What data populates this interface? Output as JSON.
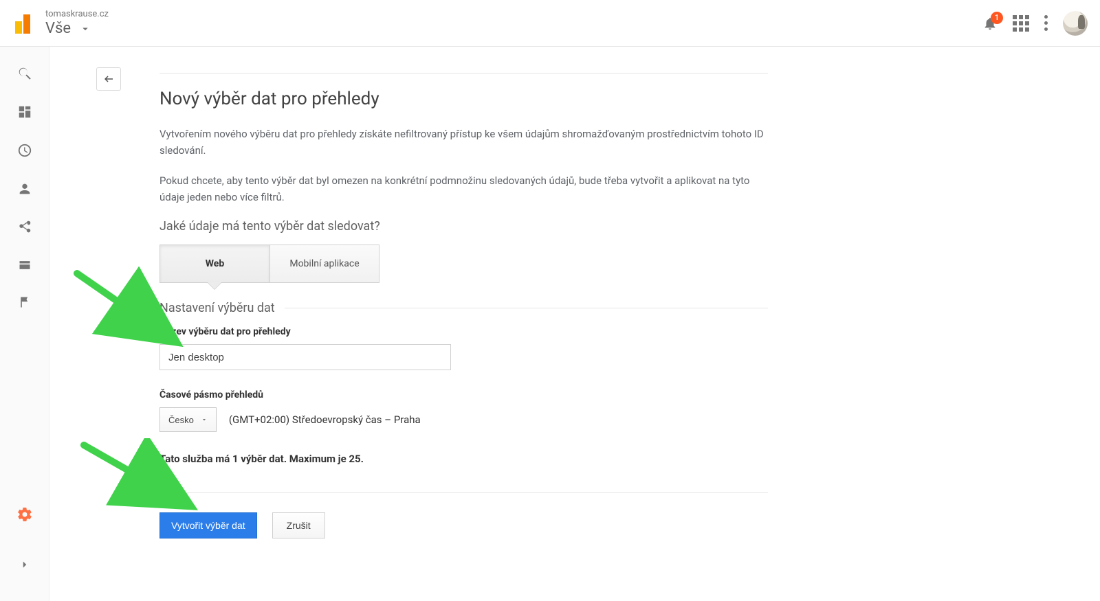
{
  "header": {
    "domain_label": "tomaskrause.cz",
    "view_label": "Vše",
    "notification_count": "1"
  },
  "page": {
    "title": "Nový výběr dat pro přehledy",
    "description_1": "Vytvořením nového výběru dat pro přehledy získáte nefiltrovaný přístup ke všem údajům shromažďovaným prostřednictvím tohoto ID sledování.",
    "description_2": "Pokud chcete, aby tento výběr dat byl omezen na konkrétní podmnožinu sledovaných údajů, bude třeba vytvořit a aplikovat na tyto údaje jeden nebo více filtrů.",
    "track_question": "Jaké údaje má tento výběr dat sledovat?",
    "toggle": {
      "web": "Web",
      "mobile": "Mobilní aplikace"
    },
    "settings_heading": "Nastavení výběru dat",
    "name_label": "Název výběru dat pro přehledy",
    "name_value": "Jen desktop",
    "tz_label": "Časové pásmo přehledů",
    "tz_country": "Česko",
    "tz_detail": "(GMT+02:00) Středoevropský čas – Praha",
    "quota_text": "Tato služba má 1 výběr dat. Maximum je 25.",
    "submit_label": "Vytvořit výběr dat",
    "cancel_label": "Zrušit"
  },
  "colors": {
    "accent": "#2b7de9",
    "arrow": "#3fd24a"
  }
}
